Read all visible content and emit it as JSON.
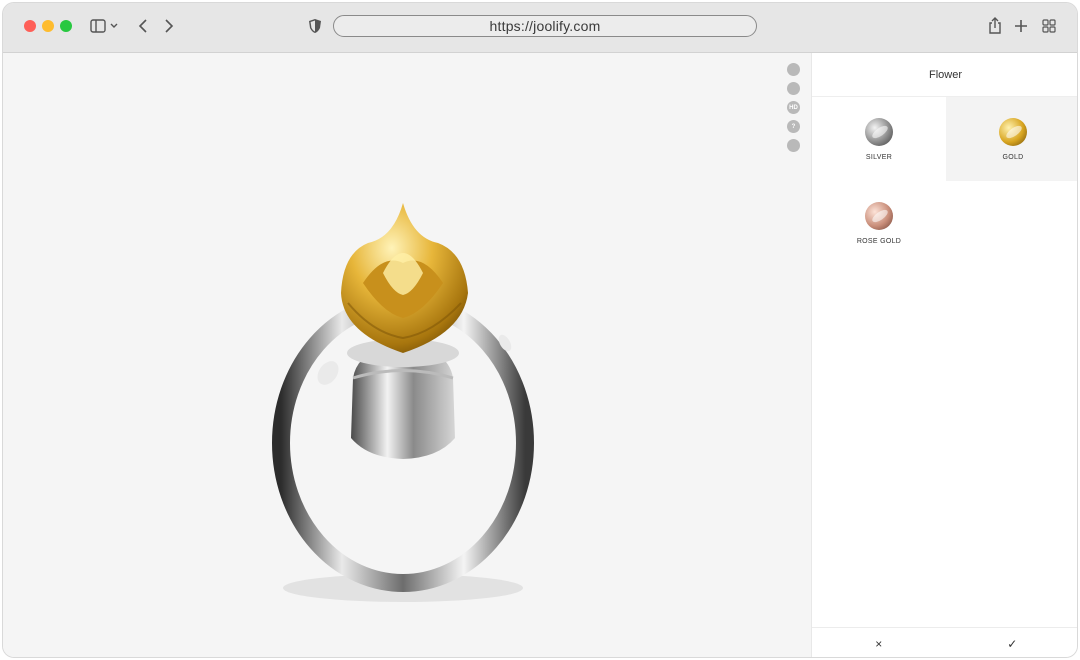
{
  "browser": {
    "url": "https://joolify.com",
    "icons": {
      "sidebar_toggle": "sidebar-icon",
      "back": "chevron-left-icon",
      "forward": "chevron-right-icon",
      "privacy": "shield-icon",
      "share": "share-icon",
      "new_tab": "plus-icon",
      "tab_overview": "grid-icon"
    }
  },
  "viewer": {
    "tools": [
      {
        "icon": "image-icon",
        "label": ""
      },
      {
        "icon": "share-icon",
        "label": ""
      },
      {
        "icon": "hd-icon",
        "label": "HD"
      },
      {
        "icon": "help-icon",
        "label": "?"
      },
      {
        "icon": "eye-icon",
        "label": ""
      }
    ]
  },
  "panel": {
    "title": "Flower",
    "options": [
      {
        "label": "SILVER",
        "swatch": "silver",
        "selected": false
      },
      {
        "label": "GOLD",
        "swatch": "gold",
        "selected": true
      },
      {
        "label": "ROSE GOLD",
        "swatch": "rose-gold",
        "selected": false
      }
    ],
    "cancel_label": "×",
    "confirm_label": "✓"
  },
  "colors": {
    "gold": "#d8a520",
    "silver": "#8d8d8d",
    "rose_gold": "#c98e7a"
  }
}
